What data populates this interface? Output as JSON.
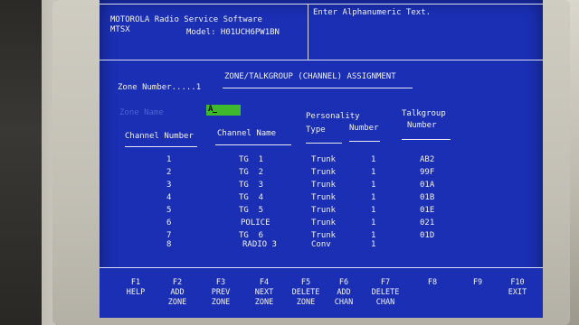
{
  "header": {
    "app_name": "MOTOROLA Radio Service Software",
    "sub": "MTSX",
    "model_label": "Model: H01UCH6PW1BN",
    "prompt": "Enter Alphanumeric Text."
  },
  "zone": {
    "zone_label": "Zone Number.....1",
    "title": "ZONE/TALKGROUP (CHANNEL) ASSIGNMENT",
    "zone_name_label": "Zone Name",
    "zone_name_value": "A"
  },
  "columns": {
    "channel_number": "Channel Number",
    "channel_name": "Channel Name",
    "personality": "Personality",
    "type": "Type",
    "number": "Number",
    "talkgroup_1": "Talkgroup",
    "talkgroup_2": "Number"
  },
  "rows": [
    {
      "ch": "1",
      "name": "TG  1",
      "type": "Trunk",
      "num": "1",
      "tg": "AB2"
    },
    {
      "ch": "2",
      "name": "TG  2",
      "type": "Trunk",
      "num": "1",
      "tg": "99F"
    },
    {
      "ch": "3",
      "name": "TG  3",
      "type": "Trunk",
      "num": "1",
      "tg": "01A"
    },
    {
      "ch": "4",
      "name": "TG  4",
      "type": "Trunk",
      "num": "1",
      "tg": "01B"
    },
    {
      "ch": "5",
      "name": "TG  5",
      "type": "Trunk",
      "num": "1",
      "tg": "01E"
    },
    {
      "ch": "6",
      "name": "POLICE",
      "type": "Trunk",
      "num": "1",
      "tg": "021"
    },
    {
      "ch": "7",
      "name": "TG  6",
      "type": "Trunk",
      "num": "1",
      "tg": "01D"
    },
    {
      "ch": "8",
      "name": "RADIO 3",
      "type": "Conv",
      "num": "1",
      "tg": ""
    }
  ],
  "fkeys": [
    {
      "key": "F1",
      "l1": "HELP",
      "l2": ""
    },
    {
      "key": "F2",
      "l1": "ADD",
      "l2": "ZONE"
    },
    {
      "key": "F3",
      "l1": "PREV",
      "l2": "ZONE"
    },
    {
      "key": "F4",
      "l1": "NEXT",
      "l2": "ZONE"
    },
    {
      "key": "F5",
      "l1": "DELETE",
      "l2": "ZONE"
    },
    {
      "key": "F6",
      "l1": "ADD",
      "l2": "CHAN"
    },
    {
      "key": "F7",
      "l1": "DELETE",
      "l2": "CHAN"
    },
    {
      "key": "F8",
      "l1": "",
      "l2": ""
    },
    {
      "key": "F9",
      "l1": "",
      "l2": ""
    },
    {
      "key": "F10",
      "l1": "EXIT",
      "l2": ""
    }
  ],
  "colors": {
    "screen_bg": "#1a2fb3",
    "field_green": "#3fb82e",
    "text": "#f2f2f2"
  }
}
